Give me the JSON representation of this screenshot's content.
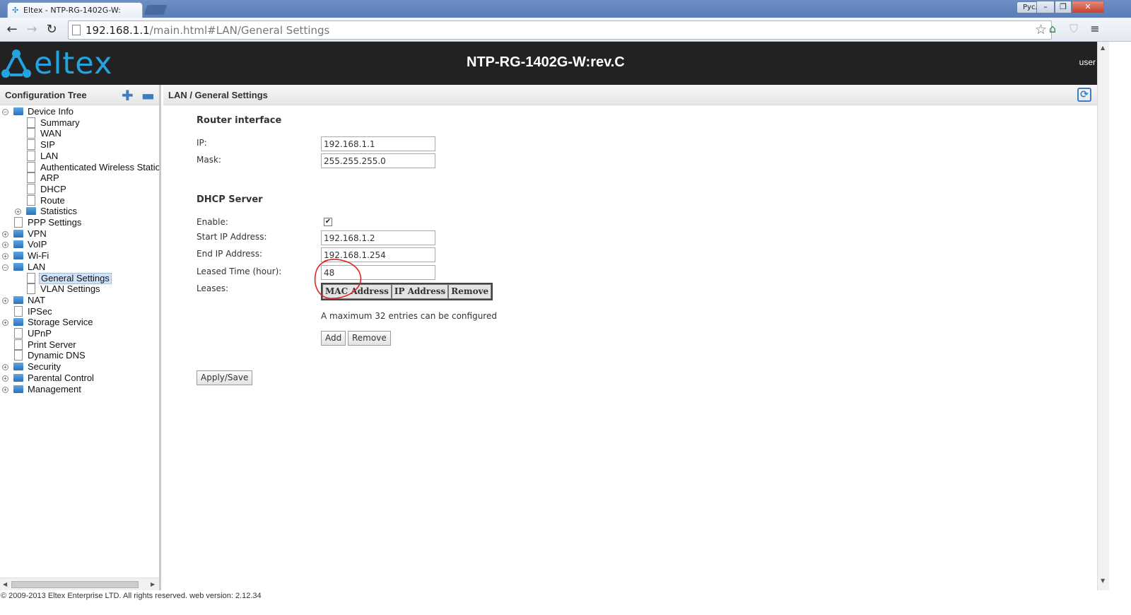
{
  "browser": {
    "tab_title": "Eltex - NTP-RG-1402G-W:",
    "window_user": "Руслан",
    "url_host": "192.168.1.1",
    "url_path": "/main.html#LAN/General Settings"
  },
  "header": {
    "logo_text": "eltex",
    "device_title": "NTP-RG-1402G-W:rev.C",
    "user": "user"
  },
  "sidebar": {
    "title": "Configuration Tree",
    "tree": [
      {
        "label": "Device Info",
        "level": 0,
        "type": "folder",
        "toggle": "minus"
      },
      {
        "label": "Summary",
        "level": 1,
        "type": "doc"
      },
      {
        "label": "WAN",
        "level": 1,
        "type": "doc"
      },
      {
        "label": "SIP",
        "level": 1,
        "type": "doc"
      },
      {
        "label": "LAN",
        "level": 1,
        "type": "doc"
      },
      {
        "label": "Authenticated Wireless Statio",
        "level": 1,
        "type": "doc"
      },
      {
        "label": "ARP",
        "level": 1,
        "type": "doc"
      },
      {
        "label": "DHCP",
        "level": 1,
        "type": "doc"
      },
      {
        "label": "Route",
        "level": 1,
        "type": "doc"
      },
      {
        "label": "Statistics",
        "level": 1,
        "type": "folder",
        "toggle": "plus"
      },
      {
        "label": "PPP Settings",
        "level": 0,
        "type": "doc"
      },
      {
        "label": "VPN",
        "level": 0,
        "type": "folder",
        "toggle": "plus"
      },
      {
        "label": "VoIP",
        "level": 0,
        "type": "folder",
        "toggle": "plus"
      },
      {
        "label": "Wi-Fi",
        "level": 0,
        "type": "folder",
        "toggle": "plus"
      },
      {
        "label": "LAN",
        "level": 0,
        "type": "folder",
        "toggle": "minus"
      },
      {
        "label": "General Settings",
        "level": 1,
        "type": "doc",
        "selected": true
      },
      {
        "label": "VLAN Settings",
        "level": 1,
        "type": "doc"
      },
      {
        "label": "NAT",
        "level": 0,
        "type": "folder",
        "toggle": "plus"
      },
      {
        "label": "IPSec",
        "level": 0,
        "type": "doc"
      },
      {
        "label": "Storage Service",
        "level": 0,
        "type": "folder",
        "toggle": "plus"
      },
      {
        "label": "UPnP",
        "level": 0,
        "type": "doc"
      },
      {
        "label": "Print Server",
        "level": 0,
        "type": "doc"
      },
      {
        "label": "Dynamic DNS",
        "level": 0,
        "type": "doc"
      },
      {
        "label": "Security",
        "level": 0,
        "type": "folder",
        "toggle": "plus"
      },
      {
        "label": "Parental Control",
        "level": 0,
        "type": "folder",
        "toggle": "plus"
      },
      {
        "label": "Management",
        "level": 0,
        "type": "folder",
        "toggle": "plus"
      }
    ]
  },
  "main": {
    "breadcrumb": "LAN / General Settings",
    "router_interface": {
      "title": "Router interface",
      "ip_label": "IP:",
      "ip_value": "192.168.1.1",
      "mask_label": "Mask:",
      "mask_value": "255.255.255.0"
    },
    "dhcp": {
      "title": "DHCP Server",
      "enable_label": "Enable:",
      "enable_checked": true,
      "start_label": "Start IP Address:",
      "start_value": "192.168.1.2",
      "end_label": "End IP Address:",
      "end_value": "192.168.1.254",
      "lease_label": "Leased Time (hour):",
      "lease_value": "48",
      "leases_label": "Leases:",
      "leases_columns": [
        "MAC Address",
        "IP Address",
        "Remove"
      ],
      "note": "A maximum 32 entries can be configured",
      "add_label": "Add",
      "remove_label": "Remove"
    },
    "apply_label": "Apply/Save"
  },
  "footer": {
    "text": "© 2009-2013 Eltex Enterprise LTD. All rights reserved. web version: 2.12.34"
  },
  "colors": {
    "brand": "#23a4e0",
    "header_bg": "#222222",
    "annotation": "#e02020"
  }
}
